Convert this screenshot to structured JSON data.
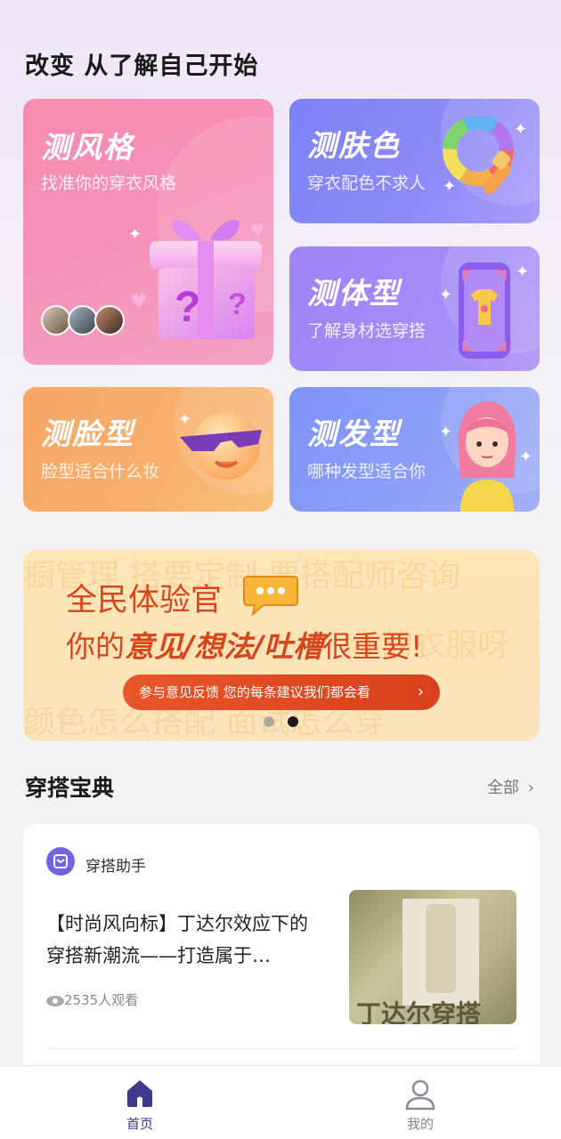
{
  "header": {
    "title": "改变 从了解自己开始"
  },
  "cards": {
    "style": {
      "title": "测风格",
      "subtitle": "找准你的穿衣风格"
    },
    "skin": {
      "title": "测肤色",
      "subtitle": "穿衣配色不求人"
    },
    "body": {
      "title": "测体型",
      "subtitle": "了解身材选穿搭"
    },
    "face": {
      "title": "测脸型",
      "subtitle": "脸型适合什么妆"
    },
    "hair": {
      "title": "测发型",
      "subtitle": "哪种发型适合你"
    }
  },
  "banner": {
    "line1": "全民体验官",
    "line2_prefix": "你的",
    "line2_bold": "意见/想法/吐槽",
    "line2_suffix": "很重要!",
    "button_label": "参与意见反馈 您的每条建议我们都会看",
    "bg_text_1": "橱管理   搭要定制   要搭配师咨询",
    "bg_text_2": "你的衣服呀",
    "bg_text_3": "颜色怎么搭配   面试怎么穿",
    "active_slide": 2,
    "slide_count": 2
  },
  "section": {
    "title": "穿搭宝典",
    "all_label": "全部"
  },
  "article": {
    "author": "穿搭助手",
    "title": "【时尚风向标】丁达尔效应下的穿搭新潮流——打造属于…",
    "views": "2535人观看",
    "thumb_text": "丁达尔穿搭"
  },
  "tabbar": {
    "home_label": "首页",
    "mine_label": "我的",
    "active": "home"
  },
  "colors": {
    "accent": "#3d3a8c",
    "banner_red": "#d6451c",
    "inactive": "#888888"
  }
}
